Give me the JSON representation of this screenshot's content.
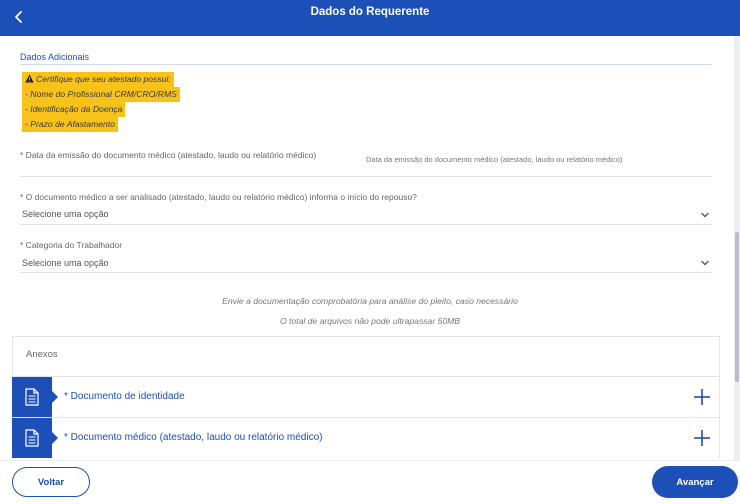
{
  "header": {
    "title": "Dados do Requerente",
    "back_icon": "chevron-left-icon",
    "color": "#1c4fb8"
  },
  "section": {
    "title": "Dados Adicionais"
  },
  "warning": {
    "icon": "warning-icon",
    "highlight_color": "#f7c21a",
    "lines": [
      "Certifique que seu atestado possui:",
      "- Nome do Profissional CRM/CRO/RMS",
      "- Identificação da Doença",
      "- Prazo de Afastamento"
    ]
  },
  "fields": {
    "emission_date": {
      "label": "* Data da emissão do documento médico (atestado, laudo ou relatório médico)",
      "placeholder": "Data da emissão do documento médico (atestado, laudo ou relatório médico)"
    },
    "rest_start": {
      "label": "* O documento médico a ser analisado (atestado, laudo ou relatório médico) informa o início do repouso?",
      "value": "Selecione uma opção"
    },
    "worker_category": {
      "label": "* Categoria do Trabalhador",
      "value": "Selecione uma opção"
    }
  },
  "info": {
    "line1": "Envie a documentação comprobatória para análise do pleito, caso necessário",
    "line2": "O total de arquivos não pode ultrapassar 50MB"
  },
  "annexes": {
    "title": "Anexos",
    "items": [
      {
        "label": "* Documento de identidade",
        "icon": "document-icon",
        "action_icon": "plus-icon"
      },
      {
        "label": "* Documento médico (atestado, laudo ou relatório médico)",
        "icon": "document-icon",
        "action_icon": "plus-icon"
      }
    ]
  },
  "footer": {
    "back_label": "Voltar",
    "next_label": "Avançar"
  }
}
